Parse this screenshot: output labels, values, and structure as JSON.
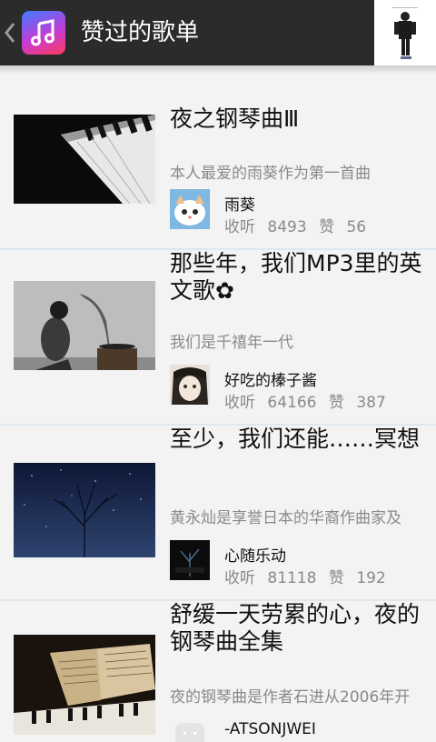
{
  "header": {
    "back_icon": "chevron-left-icon",
    "app_icon": "music-note-icon",
    "title": "赞过的歌单"
  },
  "labels": {
    "listen": "收听",
    "like": "赞"
  },
  "playlists": [
    {
      "title": "夜之钢琴曲Ⅲ",
      "description": "本人最爱的雨葵作为第一首曲",
      "user": "雨葵",
      "listen_count": "8493",
      "like_count": "56"
    },
    {
      "title": "那些年，我们MP3里的英文歌✿",
      "description": "我们是千禧年一代",
      "user": "好吃的榛子酱",
      "listen_count": "64166",
      "like_count": "387"
    },
    {
      "title": "至少，我们还能……冥想",
      "description": "黄永灿是享誉日本的华裔作曲家及",
      "user": "心随乐动",
      "listen_count": "81118",
      "like_count": "192"
    },
    {
      "title": "舒缓一天劳累的心，夜的钢琴曲全集",
      "description": "夜的钢琴曲是作者石进从2006年开",
      "user": "-ATSONJWEI"
    }
  ]
}
